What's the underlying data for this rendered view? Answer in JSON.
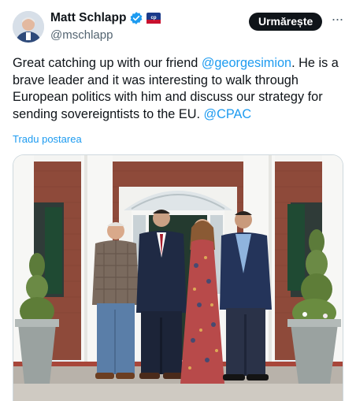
{
  "author": {
    "display_name": "Matt Schlapp",
    "handle": "@mschlapp",
    "verified_badge_icon": "verified-check-icon",
    "affiliation_badge_icon": "flag-badge-icon"
  },
  "actions": {
    "follow_label": "Urmărește",
    "more_label": "···"
  },
  "tweet": {
    "text_part1": "Great catching up with our friend ",
    "mention1": "@georgesimion",
    "text_part2": ". He is a brave leader and it was interesting to walk through European politics with him and discuss our strategy for sending sovereigntists to the EU. ",
    "mention2": "@CPAC",
    "translate_label": "Tradu postarea"
  },
  "colors": {
    "link": "#1d9bf0",
    "follow_bg": "#0f1419",
    "text": "#0f1419",
    "secondary": "#536471"
  }
}
